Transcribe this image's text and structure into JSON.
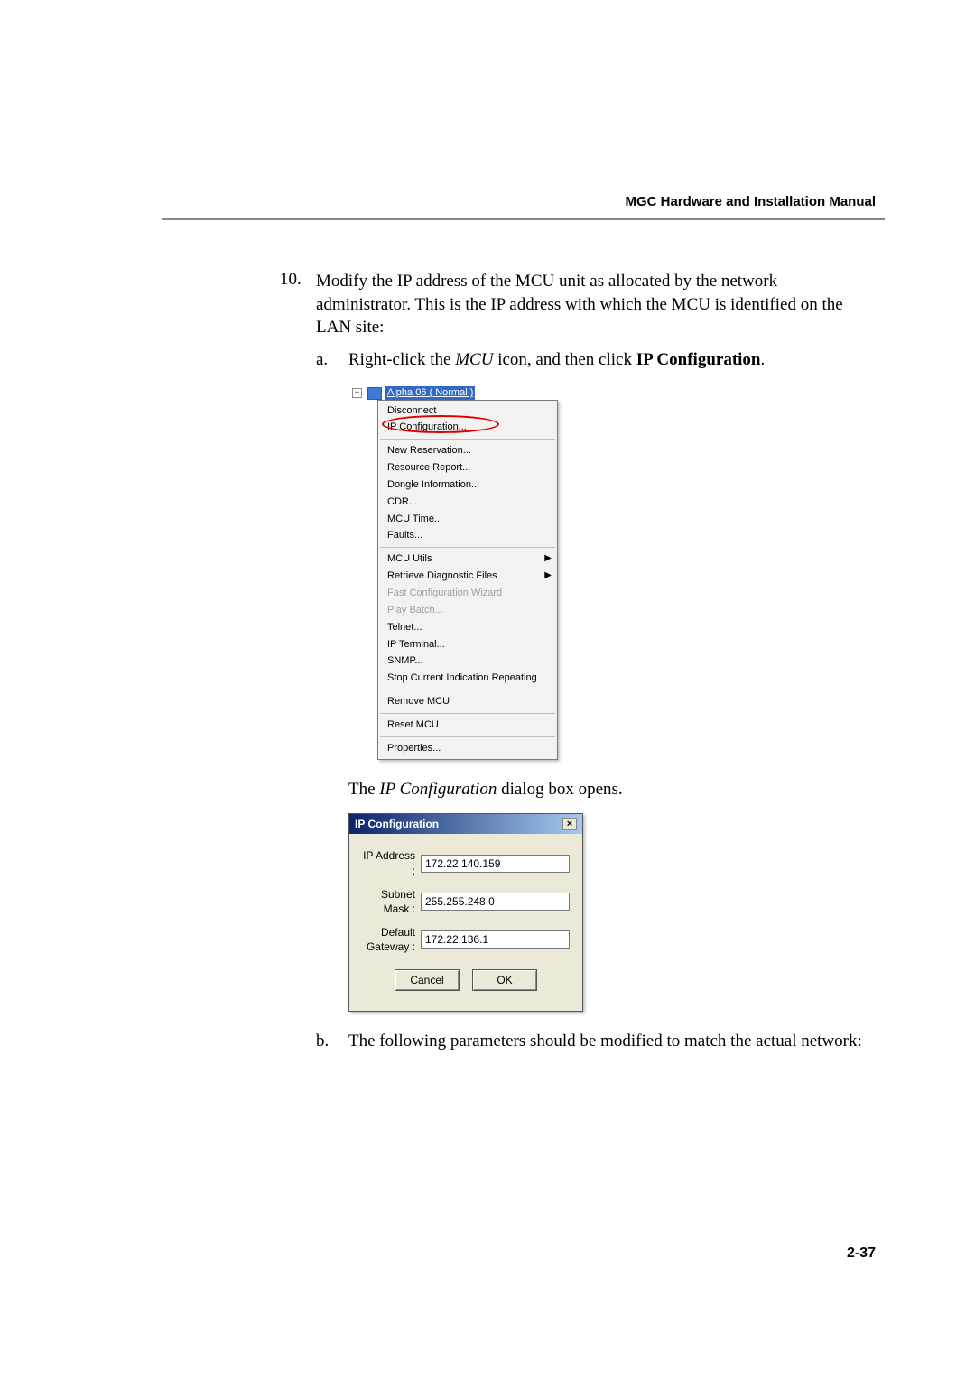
{
  "header": {
    "title": "MGC Hardware and Installation Manual"
  },
  "step": {
    "number": "10.",
    "text_before": "Modify the IP address of the MCU unit as allocated by the network administrator. This is the IP address with which the MCU is identified on the LAN site:"
  },
  "sub_a": {
    "letter": "a.",
    "text_prefix": "Right-click the ",
    "text_italic": "MCU",
    "text_mid": " icon, and then click ",
    "text_bold": "IP Configuration",
    "text_suffix": "."
  },
  "tree": {
    "node_label": "Alpha 06   ( Normal )"
  },
  "menu": {
    "items_g1": [
      "Disconnect",
      "IP Configuration..."
    ],
    "items_g2": [
      "New Reservation...",
      "Resource Report...",
      "Dongle Information...",
      "CDR...",
      "MCU Time...",
      "Faults..."
    ],
    "items_g3": [
      {
        "label": "MCU Utils",
        "arrow": true,
        "disabled": false
      },
      {
        "label": "Retrieve Diagnostic Files",
        "arrow": true,
        "disabled": false
      },
      {
        "label": "Fast Configuration Wizard",
        "arrow": false,
        "disabled": true
      },
      {
        "label": "Play Batch...",
        "arrow": false,
        "disabled": true
      },
      {
        "label": "Telnet...",
        "arrow": false,
        "disabled": false
      },
      {
        "label": "IP Terminal...",
        "arrow": false,
        "disabled": false
      },
      {
        "label": "SNMP...",
        "arrow": false,
        "disabled": false
      },
      {
        "label": "Stop Current Indication Repeating",
        "arrow": false,
        "disabled": false
      }
    ],
    "items_g4": [
      "Remove MCU"
    ],
    "items_g5": [
      "Reset MCU"
    ],
    "items_g6": [
      "Properties..."
    ]
  },
  "caption": {
    "prefix": "The ",
    "italic": "IP Configuration",
    "suffix": " dialog box opens."
  },
  "dialog": {
    "title": "IP Configuration",
    "fields": {
      "ip_label": "IP Address :",
      "ip_value": "172.22.140.159",
      "mask_label": "Subnet Mask :",
      "mask_value": "255.255.248.0",
      "gw_label": "Default Gateway :",
      "gw_value": "172.22.136.1"
    },
    "buttons": {
      "cancel": "Cancel",
      "ok": "OK"
    }
  },
  "sub_b": {
    "letter": "b.",
    "text": "The following parameters should be modified to match the actual network:"
  },
  "page_number": "2-37"
}
